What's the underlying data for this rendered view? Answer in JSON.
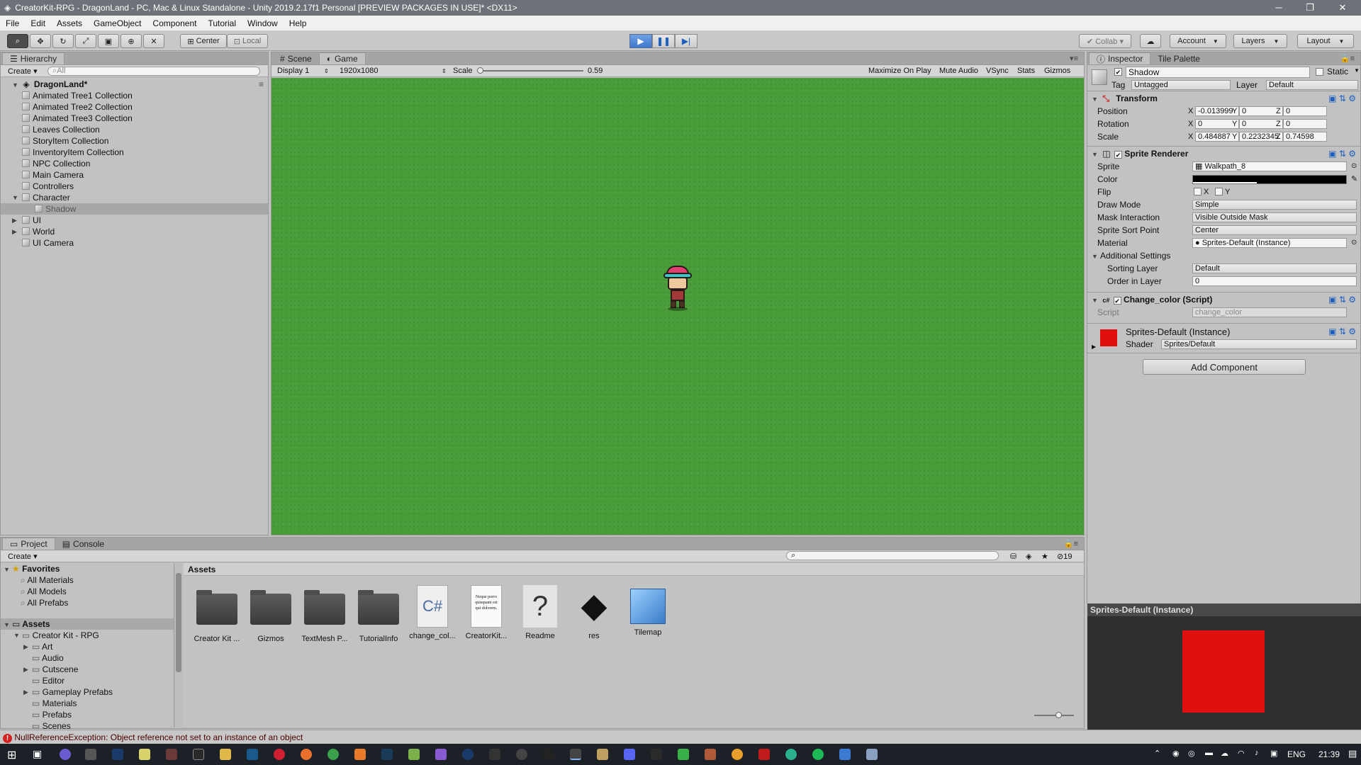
{
  "window": {
    "title": "CreatorKit-RPG - DragonLand - PC, Mac & Linux Standalone - Unity 2019.2.17f1 Personal [PREVIEW PACKAGES IN USE]* <DX11>",
    "minimize": "─",
    "maximize": "❐",
    "close": "✕"
  },
  "menu": [
    "File",
    "Edit",
    "Assets",
    "GameObject",
    "Component",
    "Tutorial",
    "Window",
    "Help"
  ],
  "toolbar": {
    "center_label": "Center",
    "local_label": "Local",
    "collab_label": "Collab ▾",
    "account_label": "Account",
    "layers_label": "Layers",
    "layout_label": "Layout"
  },
  "hierarchy": {
    "tab": "Hierarchy",
    "create": "Create ▾",
    "search_placeholder": "All",
    "scene": "DragonLand*",
    "items": [
      {
        "label": "Animated Tree1 Collection",
        "indent": 1,
        "arrow": ""
      },
      {
        "label": "Animated Tree2 Collection",
        "indent": 1,
        "arrow": ""
      },
      {
        "label": "Animated Tree3 Collection",
        "indent": 1,
        "arrow": ""
      },
      {
        "label": "Leaves Collection",
        "indent": 1,
        "arrow": ""
      },
      {
        "label": "StoryItem Collection",
        "indent": 1,
        "arrow": ""
      },
      {
        "label": "InventoryItem Collection",
        "indent": 1,
        "arrow": ""
      },
      {
        "label": "NPC Collection",
        "indent": 1,
        "arrow": ""
      },
      {
        "label": "Main Camera",
        "indent": 1,
        "arrow": ""
      },
      {
        "label": "Controllers",
        "indent": 1,
        "arrow": ""
      },
      {
        "label": "Character",
        "indent": 1,
        "arrow": "▼"
      },
      {
        "label": "Shadow",
        "indent": 2,
        "arrow": "",
        "selected": true
      },
      {
        "label": "UI",
        "indent": 1,
        "arrow": "▶"
      },
      {
        "label": "World",
        "indent": 1,
        "arrow": "▶"
      },
      {
        "label": "UI Camera",
        "indent": 1,
        "arrow": ""
      }
    ]
  },
  "game_view": {
    "tabs": [
      "Scene",
      "Game"
    ],
    "display": "Display 1",
    "resolution": "1920x1080",
    "scale_label": "Scale",
    "scale_value": "0.59",
    "toggles": [
      "Maximize On Play",
      "Mute Audio",
      "VSync",
      "Stats",
      "Gizmos"
    ],
    "background_color": "#4a9c3b"
  },
  "inspector": {
    "tabs": [
      "Inspector",
      "Tile Palette"
    ],
    "object_name": "Shadow",
    "static_label": "Static",
    "tag_label": "Tag",
    "tag_value": "Untagged",
    "layer_label": "Layer",
    "layer_value": "Default",
    "transform": {
      "title": "Transform",
      "rows": [
        {
          "label": "Position",
          "x": "-0.013999",
          "y": "0",
          "z": "0"
        },
        {
          "label": "Rotation",
          "x": "0",
          "y": "0",
          "z": "0"
        },
        {
          "label": "Scale",
          "x": "0.484887",
          "y": "0.2232345",
          "z": "0.74598"
        }
      ]
    },
    "sprite_renderer": {
      "title": "Sprite Renderer",
      "sprite_label": "Sprite",
      "sprite_value": "Walkpath_8",
      "color_label": "Color",
      "flip_label": "Flip",
      "flip_x": "X",
      "flip_y": "Y",
      "draw_mode_label": "Draw Mode",
      "draw_mode_value": "Simple",
      "mask_label": "Mask Interaction",
      "mask_value": "Visible Outside Mask",
      "sort_point_label": "Sprite Sort Point",
      "sort_point_value": "Center",
      "material_label": "Material",
      "material_value": "Sprites-Default (Instance)",
      "additional_label": "Additional Settings",
      "sorting_layer_label": "Sorting Layer",
      "sorting_layer_value": "Default",
      "order_label": "Order in Layer",
      "order_value": "0"
    },
    "script_component": {
      "title": "Change_color (Script)",
      "script_label": "Script",
      "script_value": "change_color"
    },
    "material": {
      "title": "Sprites-Default (Instance)",
      "shader_label": "Shader",
      "shader_value": "Sprites/Default",
      "swatch_color": "#e01010"
    },
    "add_component": "Add Component",
    "preview_title": "Sprites-Default (Instance)"
  },
  "project": {
    "tabs": [
      "Project",
      "Console"
    ],
    "create": "Create ▾",
    "search_placeholder": "",
    "count": "19",
    "favorites_label": "Favorites",
    "favorites": [
      "All Materials",
      "All Models",
      "All Prefabs"
    ],
    "assets_label": "Assets",
    "tree": [
      {
        "label": "Creator Kit - RPG",
        "indent": 1,
        "arrow": "▼"
      },
      {
        "label": "Art",
        "indent": 2,
        "arrow": "▶"
      },
      {
        "label": "Audio",
        "indent": 2,
        "arrow": ""
      },
      {
        "label": "Cutscene",
        "indent": 2,
        "arrow": "▶"
      },
      {
        "label": "Editor",
        "indent": 2,
        "arrow": ""
      },
      {
        "label": "Gameplay Prefabs",
        "indent": 2,
        "arrow": "▶"
      },
      {
        "label": "Materials",
        "indent": 2,
        "arrow": ""
      },
      {
        "label": "Prefabs",
        "indent": 2,
        "arrow": ""
      },
      {
        "label": "Scenes",
        "indent": 2,
        "arrow": ""
      }
    ],
    "breadcrumb": "Assets",
    "assets": [
      {
        "label": "Creator Kit ...",
        "kind": "folder"
      },
      {
        "label": "Gizmos",
        "kind": "folder"
      },
      {
        "label": "TextMesh P...",
        "kind": "folder"
      },
      {
        "label": "TutorialInfo",
        "kind": "folder"
      },
      {
        "label": "change_col...",
        "kind": "script",
        "glyph": "C#"
      },
      {
        "label": "CreatorKit...",
        "kind": "doc",
        "glyph": "Neque porro quisquam est qui dolorem."
      },
      {
        "label": "Readme",
        "kind": "readme",
        "glyph": "?"
      },
      {
        "label": "res",
        "kind": "unity",
        "glyph": "◆"
      },
      {
        "label": "Tilemap",
        "kind": "cube"
      }
    ]
  },
  "status": {
    "message": "NullReferenceException: Object reference not set to an instance of an object"
  },
  "taskbar": {
    "lang": "ENG",
    "time": "21:39"
  }
}
